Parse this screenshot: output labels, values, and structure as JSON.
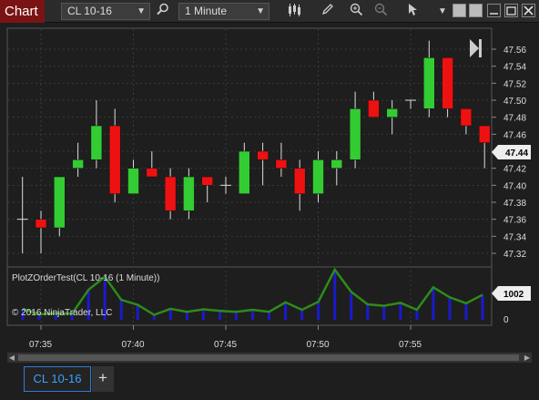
{
  "toolbar": {
    "title": "Chart",
    "instrument": "CL 10-16",
    "interval": "1 Minute"
  },
  "icons": [
    "chevron-down-icon",
    "search-icon",
    "bar-type-icon",
    "pencil-icon",
    "zoom-in-icon",
    "zoom-out-icon",
    "pointer-icon",
    "dropdown-icon",
    "minimize-icon",
    "maximize-icon",
    "restore-icon",
    "close-icon",
    "scroll-end-icon"
  ],
  "colors": {
    "up": "#33cc33",
    "down": "#ee1111",
    "indicator_line": "#2e8b1a",
    "indicator_bar": "#1a1acc",
    "background": "#1e1e1e",
    "grid": "#3a3a3a"
  },
  "price_axis": {
    "ticks": [
      "47.56",
      "47.54",
      "47.52",
      "47.50",
      "47.48",
      "47.46",
      "47.44",
      "47.42",
      "47.40",
      "47.38",
      "47.36",
      "47.34",
      "47.32"
    ],
    "last_price": "47.44"
  },
  "indicator": {
    "title": "PlotZOrderTest(CL 10-16 (1 Minute))",
    "copyright": "© 2016 NinjaTrader, LLC",
    "axis_top": "1002",
    "axis_zero": "0"
  },
  "time_axis": {
    "ticks": [
      "07:35",
      "07:40",
      "07:45",
      "07:50",
      "07:55"
    ]
  },
  "tabs": {
    "active": "CL 10-16",
    "add": "+"
  },
  "chart_data": {
    "type": "candlestick",
    "ylim": [
      47.315,
      47.575
    ],
    "candles": [
      {
        "t": "07:34",
        "o": 47.36,
        "h": 47.41,
        "l": 47.32,
        "c": 47.36
      },
      {
        "t": "07:35",
        "o": 47.36,
        "h": 47.37,
        "l": 47.32,
        "c": 47.35
      },
      {
        "t": "07:36",
        "o": 47.35,
        "h": 47.41,
        "l": 47.34,
        "c": 47.41
      },
      {
        "t": "07:37",
        "o": 47.42,
        "h": 47.45,
        "l": 47.41,
        "c": 47.43
      },
      {
        "t": "07:38",
        "o": 47.43,
        "h": 47.5,
        "l": 47.42,
        "c": 47.47
      },
      {
        "t": "07:39",
        "o": 47.47,
        "h": 47.49,
        "l": 47.38,
        "c": 47.39
      },
      {
        "t": "07:40",
        "o": 47.39,
        "h": 47.43,
        "l": 47.39,
        "c": 47.42
      },
      {
        "t": "07:41",
        "o": 47.42,
        "h": 47.44,
        "l": 47.41,
        "c": 47.41
      },
      {
        "t": "07:42",
        "o": 47.41,
        "h": 47.42,
        "l": 47.36,
        "c": 47.37
      },
      {
        "t": "07:43",
        "o": 47.37,
        "h": 47.42,
        "l": 47.36,
        "c": 47.41
      },
      {
        "t": "07:44",
        "o": 47.41,
        "h": 47.41,
        "l": 47.38,
        "c": 47.4
      },
      {
        "t": "07:45",
        "o": 47.4,
        "h": 47.41,
        "l": 47.39,
        "c": 47.4
      },
      {
        "t": "07:46",
        "o": 47.39,
        "h": 47.45,
        "l": 47.39,
        "c": 47.44
      },
      {
        "t": "07:47",
        "o": 47.44,
        "h": 47.45,
        "l": 47.4,
        "c": 47.43
      },
      {
        "t": "07:48",
        "o": 47.43,
        "h": 47.45,
        "l": 47.41,
        "c": 47.42
      },
      {
        "t": "07:49",
        "o": 47.42,
        "h": 47.43,
        "l": 47.37,
        "c": 47.39
      },
      {
        "t": "07:50",
        "o": 47.39,
        "h": 47.44,
        "l": 47.38,
        "c": 47.43
      },
      {
        "t": "07:51",
        "o": 47.42,
        "h": 47.44,
        "l": 47.4,
        "c": 47.43
      },
      {
        "t": "07:52",
        "o": 47.43,
        "h": 47.51,
        "l": 47.42,
        "c": 47.49
      },
      {
        "t": "07:53",
        "o": 47.5,
        "h": 47.51,
        "l": 47.48,
        "c": 47.48
      },
      {
        "t": "07:54",
        "o": 47.48,
        "h": 47.5,
        "l": 47.46,
        "c": 47.49
      },
      {
        "t": "07:55",
        "o": 47.5,
        "h": 47.5,
        "l": 47.49,
        "c": 47.5
      },
      {
        "t": "07:56",
        "o": 47.49,
        "h": 47.57,
        "l": 47.48,
        "c": 47.55
      },
      {
        "t": "07:57",
        "o": 47.55,
        "h": 47.55,
        "l": 47.48,
        "c": 47.49
      },
      {
        "t": "07:58",
        "o": 47.49,
        "h": 47.49,
        "l": 47.46,
        "c": 47.47
      },
      {
        "t": "07:59",
        "o": 47.47,
        "h": 47.47,
        "l": 47.42,
        "c": 47.45
      }
    ],
    "indicator_values": [
      220,
      110,
      130,
      120,
      600,
      860,
      400,
      300,
      100,
      220,
      160,
      210,
      180,
      160,
      200,
      160,
      350,
      200,
      360,
      1002,
      560,
      310,
      280,
      340,
      200,
      650,
      450,
      330,
      500
    ]
  }
}
